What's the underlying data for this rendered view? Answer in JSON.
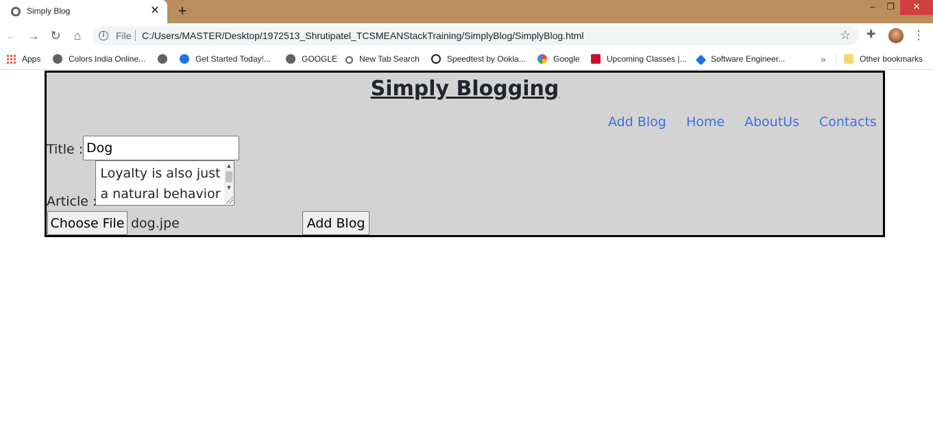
{
  "browser": {
    "tab": {
      "title": "Simply Blog",
      "close": "✕"
    },
    "new_tab": "+",
    "window": {
      "minimize": "–",
      "restore": "❐",
      "close": "✕"
    },
    "address": {
      "scheme": "File",
      "url": "C:/Users/MASTER/Desktop/1972513_Shrutipatel_TCSMEANStackTraining/SimplyBlog/SimplyBlog.html"
    },
    "icons": [
      "back-arrow-icon",
      "forward-arrow-icon",
      "reload-icon",
      "home-icon",
      "info-icon",
      "star-icon",
      "extensions-icon",
      "menu-icon"
    ],
    "bookmarks": [
      {
        "label": "Apps",
        "icon": "apps-grid-icon"
      },
      {
        "label": "Colors India Online...",
        "icon": "globe-icon"
      },
      {
        "label": "",
        "icon": "globe-icon"
      },
      {
        "label": "Get Started Today!...",
        "icon": "q-logo-icon"
      },
      {
        "label": "GOOGLE",
        "icon": "globe-icon"
      },
      {
        "label": "New Tab Search",
        "icon": "search-icon"
      },
      {
        "label": "Speedtest by Ookla...",
        "icon": "speedometer-icon"
      },
      {
        "label": "Google",
        "icon": "google-g-icon"
      },
      {
        "label": "Upcoming Classes |...",
        "icon": "r-logo-icon"
      },
      {
        "label": "Software Engineer...",
        "icon": "diamond-logo-icon"
      }
    ],
    "bookmarks_more": "»",
    "other_bookmarks": "Other bookmarks"
  },
  "page": {
    "site_title": "Simply Blogging",
    "nav": [
      "Add Blog",
      "Home",
      "AboutUs",
      "Contacts"
    ],
    "form": {
      "title_label": "Title :",
      "title_value": "Dog",
      "article_label": "Article :",
      "article_value": "Loyalty is also just a natural behavior",
      "file_button": "Choose File",
      "file_name": "dog.jpe",
      "submit": "Add Blog"
    }
  },
  "colors": {
    "titlebar": "#bb8e5e",
    "page_background": "#d3d3d3",
    "link": "#3a70e0",
    "close_button": "#d33f3f"
  }
}
